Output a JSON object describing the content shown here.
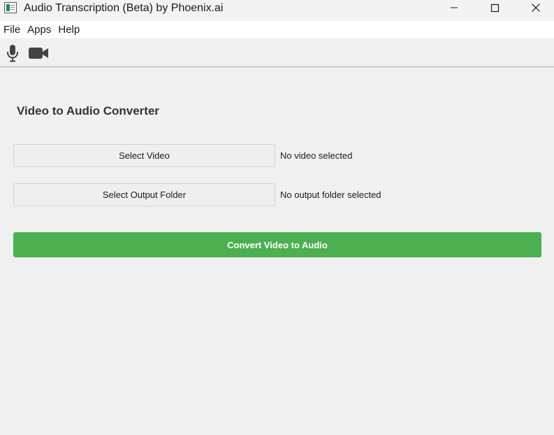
{
  "window": {
    "title": "Audio Transcription (Beta) by Phoenix.ai",
    "app_icon": "app-window-icon",
    "controls": [
      "minimize-icon",
      "maximize-icon",
      "close-icon"
    ]
  },
  "menubar": {
    "items": [
      {
        "label": "File"
      },
      {
        "label": "Apps"
      },
      {
        "label": "Help"
      }
    ]
  },
  "toolbar": {
    "tools": [
      {
        "icon": "microphone-icon"
      },
      {
        "icon": "video-camera-icon"
      }
    ]
  },
  "converter": {
    "title": "Video to Audio Converter",
    "select_video_label": "Select Video",
    "video_status": "No video selected",
    "select_output_label": "Select Output Folder",
    "output_status": "No output folder selected",
    "convert_label": "Convert Video to Audio"
  },
  "colors": {
    "accent": "#4caf50",
    "background": "#f0f0f0",
    "menubar": "#ffffff",
    "heading": "#333333"
  }
}
